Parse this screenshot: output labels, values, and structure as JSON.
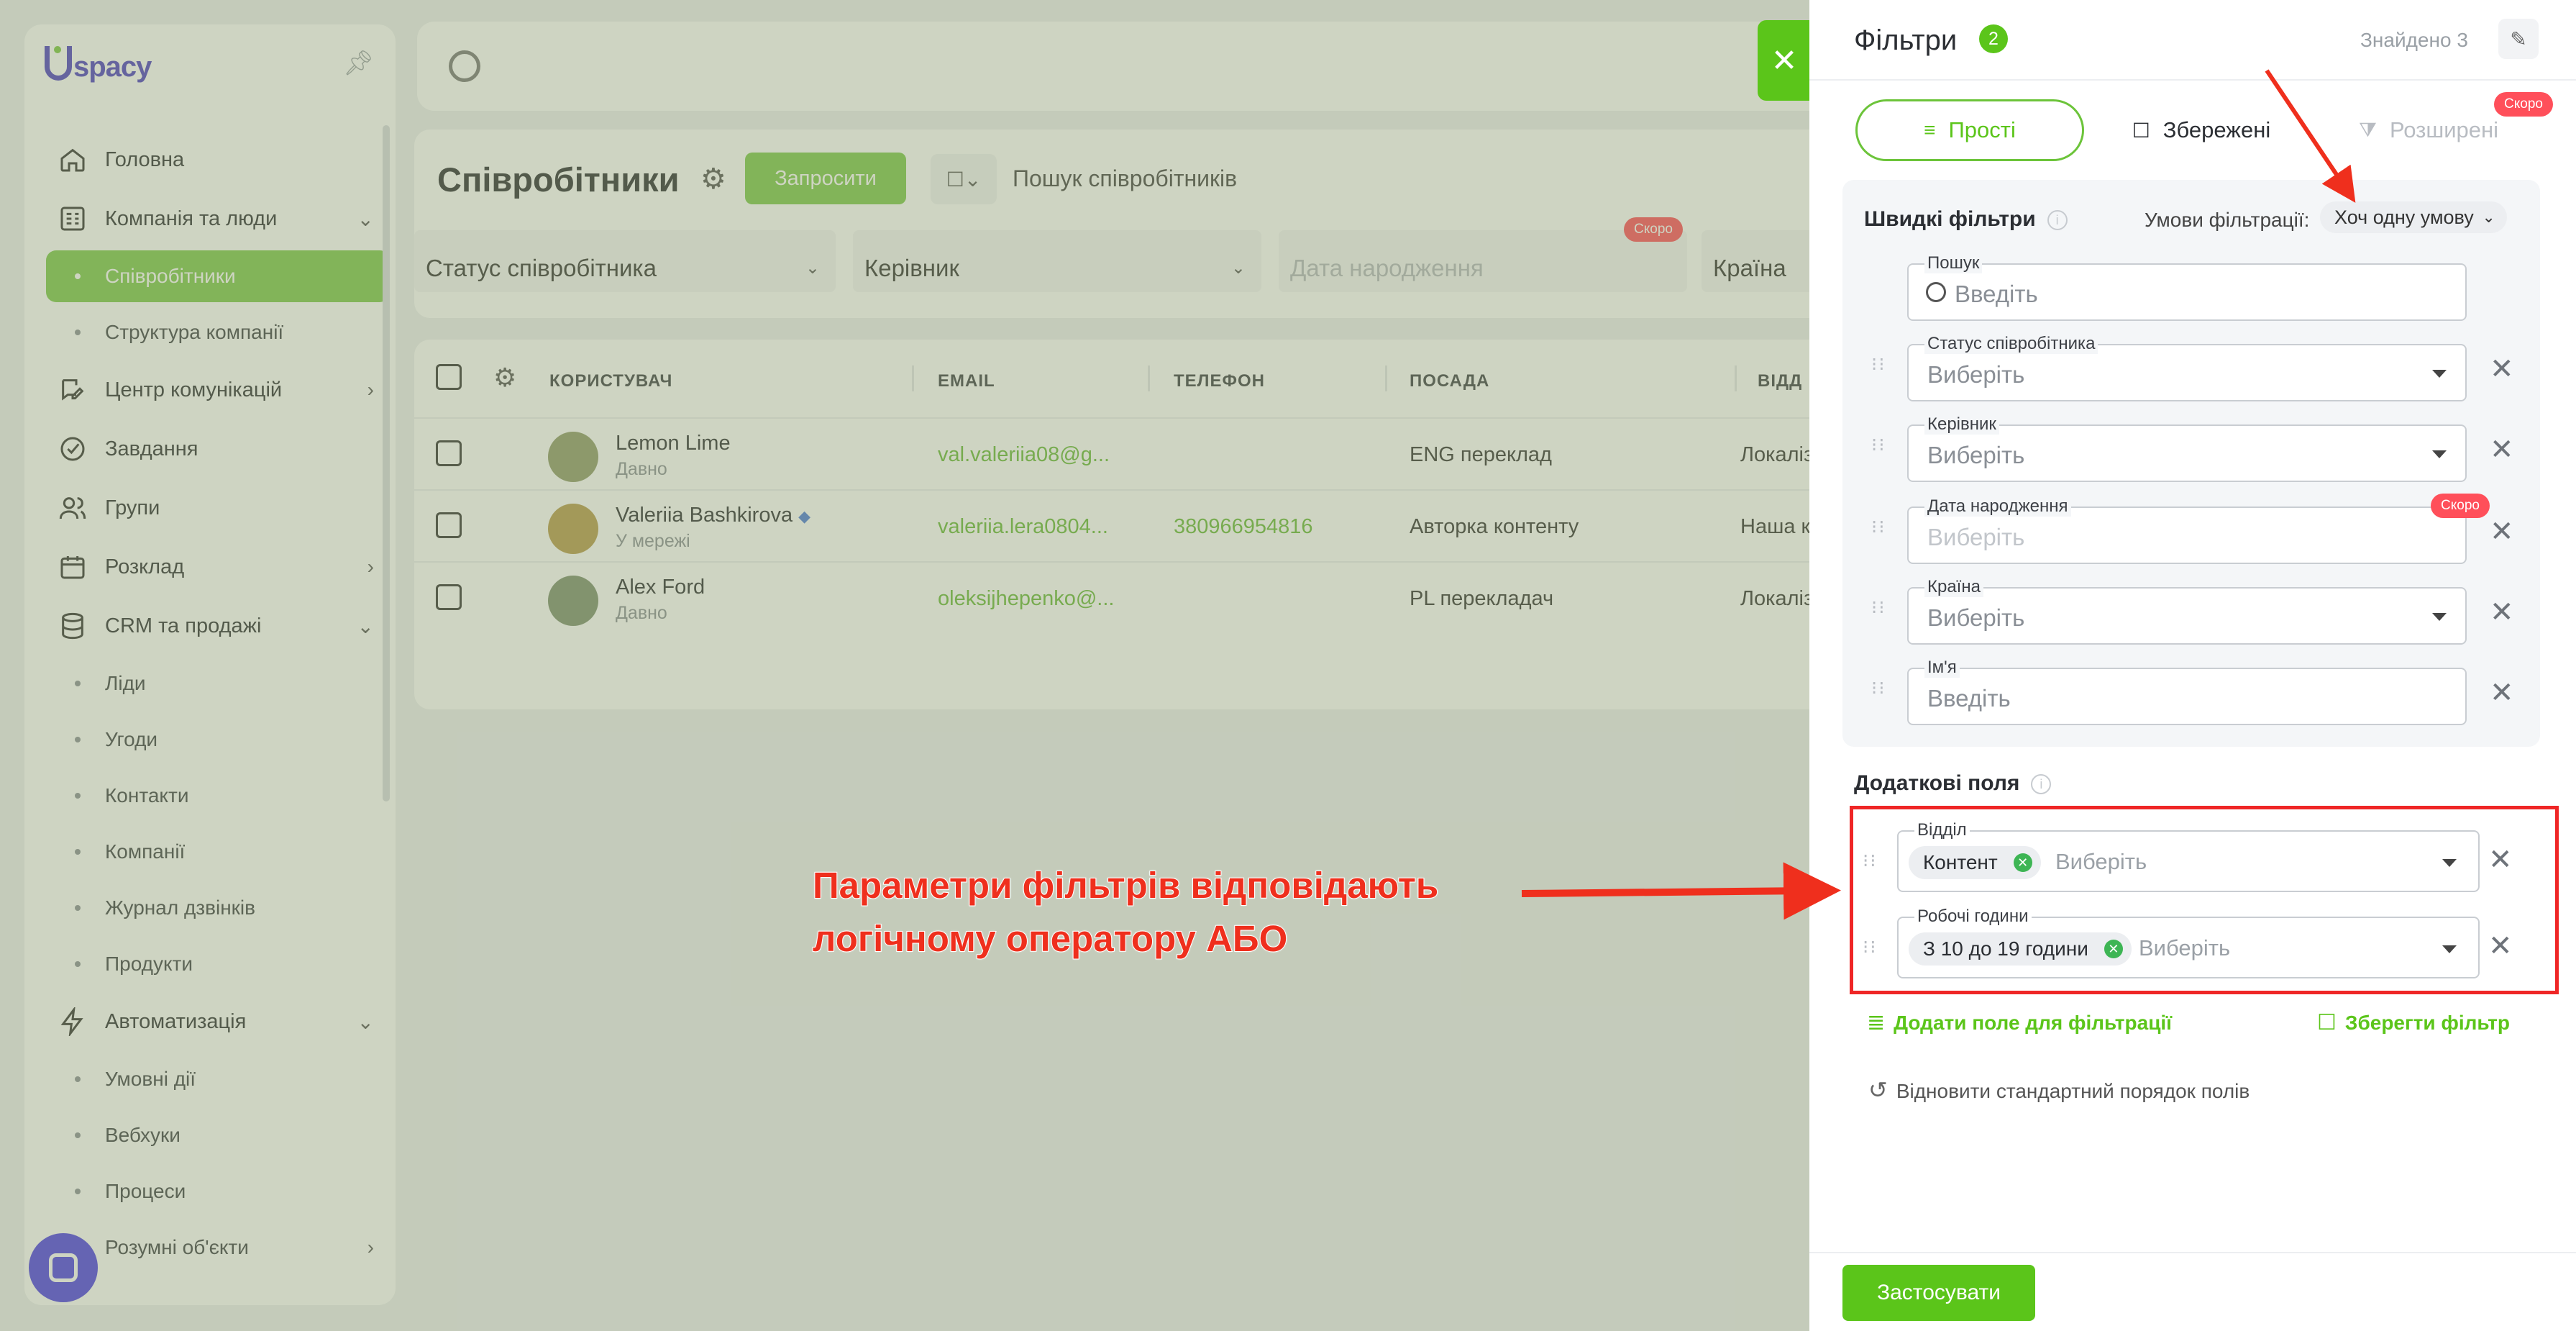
{
  "sidebar": {
    "logo": "spacy",
    "nav": [
      {
        "label": "Головна",
        "icon": "home-icon"
      },
      {
        "label": "Компанія та люди",
        "icon": "building-icon",
        "expanded": true
      },
      {
        "label": "Співробітники",
        "sub": true,
        "active": true
      },
      {
        "label": "Структура компанії",
        "sub": true
      },
      {
        "label": "Центр комунікацій",
        "icon": "chat-edit-icon",
        "expanded": false
      },
      {
        "label": "Завдання",
        "icon": "check-circle-icon"
      },
      {
        "label": "Групи",
        "icon": "users-icon"
      },
      {
        "label": "Розклад",
        "icon": "calendar-icon",
        "expanded": false
      },
      {
        "label": "CRM та продажі",
        "icon": "database-icon",
        "expanded": true
      },
      {
        "label": "Ліди",
        "sub": true
      },
      {
        "label": "Угоди",
        "sub": true
      },
      {
        "label": "Контакти",
        "sub": true
      },
      {
        "label": "Компанії",
        "sub": true
      },
      {
        "label": "Журнал дзвінків",
        "sub": true
      },
      {
        "label": "Продукти",
        "sub": true
      },
      {
        "label": "Автоматизація",
        "icon": "lightning-icon",
        "expanded": true
      },
      {
        "label": "Умовні дії",
        "sub": true
      },
      {
        "label": "Вебхуки",
        "sub": true
      },
      {
        "label": "Процеси",
        "sub": true
      },
      {
        "label": "Розумні об'єкти",
        "sub": true
      }
    ]
  },
  "main": {
    "title": "Співробітники",
    "invite_label": "Запросити",
    "search_placeholder": "Пошук співробітників",
    "filters": [
      {
        "label": "Статус співробітника"
      },
      {
        "label": "Керівник"
      },
      {
        "label": "Дата народження",
        "placeholder": true,
        "badge": "Скоро"
      },
      {
        "label": "Країна"
      }
    ],
    "table": {
      "headers": [
        "КОРИСТУВАЧ",
        "EMAIL",
        "ТЕЛЕФОН",
        "ПОСАДА",
        "ВІДД"
      ],
      "rows": [
        {
          "name": "Lemon Lime",
          "status": "Давно",
          "email": "val.valeriia08@g...",
          "phone": "",
          "position": "ENG переклад",
          "department": "Локаліз"
        },
        {
          "name": "Valeriia Bashkirova",
          "status": "У мережі",
          "email": "valeriia.lera0804...",
          "phone": "380966954816",
          "position": "Авторка контенту",
          "department": "Наша к"
        },
        {
          "name": "Alex Ford",
          "status": "Давно",
          "email": "oleksijhepenko@...",
          "phone": "",
          "position": "PL перекладач",
          "department": "Локаліз"
        }
      ]
    }
  },
  "panel": {
    "title": "Фільтри",
    "count": "2",
    "found": "Знайдено 3",
    "tabs": [
      {
        "label": "Прості",
        "icon": "sliders-icon"
      },
      {
        "label": "Збережені",
        "icon": "bookmark-icon"
      },
      {
        "label": "Розширені",
        "icon": "filter-icon",
        "badge": "Скоро"
      }
    ],
    "quick": {
      "title": "Швидкі фільтри",
      "condition_label": "Умови фільтрації:",
      "condition_value": "Хоч одну умову",
      "fields": [
        {
          "label": "Пошук",
          "value": "Введіть"
        },
        {
          "label": "Статус співробітника",
          "value": "Виберіть"
        },
        {
          "label": "Керівник",
          "value": "Виберіть"
        },
        {
          "label": "Дата народження",
          "value": "Виберіть",
          "badge": "Скоро"
        },
        {
          "label": "Країна",
          "value": "Виберіть"
        },
        {
          "label": "Ім'я",
          "value": "Введіть"
        }
      ]
    },
    "extra": {
      "title": "Додаткові поля",
      "fields": [
        {
          "label": "Відділ",
          "chip": "Контент",
          "placeholder": "Виберіть"
        },
        {
          "label": "Робочі години",
          "chip": "З 10 до 19 години",
          "placeholder": "Виберіть"
        }
      ]
    },
    "add_field": "Додати поле для фільтрації",
    "save_filter": "Зберегти фільтр",
    "restore": "Відновити стандартний порядок полів",
    "apply": "Застосувати"
  },
  "annotation": {
    "line1": "Параметри фільтрів відповідають",
    "line2": "логічному оператору АБО",
    "color": "#ef2f1d"
  },
  "colors": {
    "accent": "#5bc51a",
    "badge": "#ff4f5a",
    "highlight": "#ef2626"
  }
}
